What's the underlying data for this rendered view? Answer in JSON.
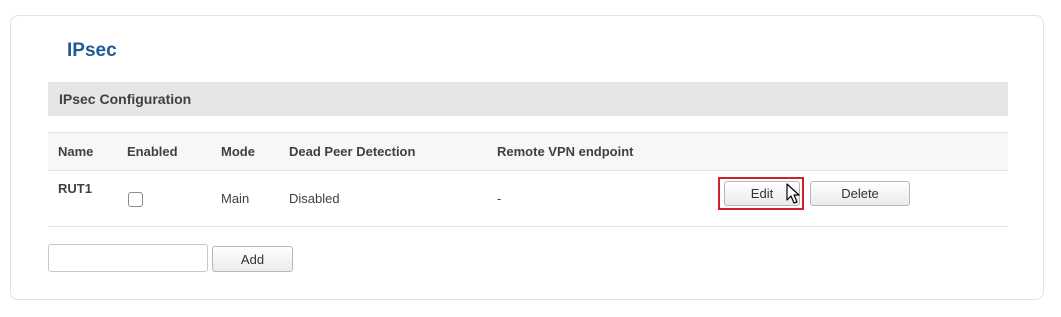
{
  "page": {
    "title": "IPsec"
  },
  "section": {
    "title": "IPsec Configuration"
  },
  "table": {
    "columns": [
      "Name",
      "Enabled",
      "Mode",
      "Dead Peer Detection",
      "Remote VPN endpoint"
    ],
    "rows": [
      {
        "name": "RUT1",
        "enabled": false,
        "mode": "Main",
        "dead_peer_detection": "Disabled",
        "remote_vpn_endpoint": "-",
        "edit_label": "Edit",
        "delete_label": "Delete"
      }
    ]
  },
  "add_form": {
    "input_value": "",
    "add_label": "Add"
  },
  "colors": {
    "title": "#1f5a96",
    "highlight": "#d0202a",
    "section_bg": "#e6e6e6"
  },
  "icons": {
    "cursor": "mouse-pointer-icon"
  }
}
